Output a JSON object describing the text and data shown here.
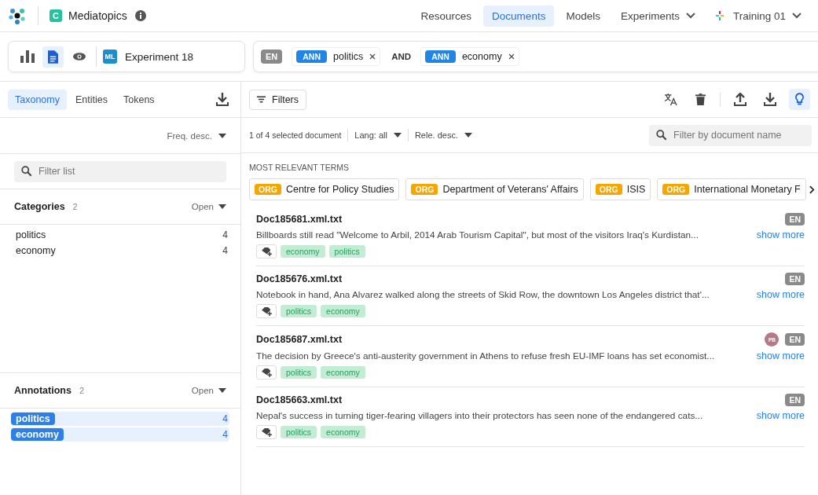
{
  "app": {
    "badge": "C",
    "title": "Mediatopics"
  },
  "nav": [
    {
      "label": "Resources",
      "selected": false,
      "dropdown": false
    },
    {
      "label": "Documents",
      "selected": true,
      "dropdown": false
    },
    {
      "label": "Models",
      "selected": false,
      "dropdown": false
    },
    {
      "label": "Experiments",
      "selected": false,
      "dropdown": true
    }
  ],
  "training": {
    "label": "Training 01"
  },
  "views": [
    {
      "kind": "chart",
      "selected": false
    },
    {
      "kind": "document",
      "selected": true
    },
    {
      "kind": "eye",
      "selected": false
    }
  ],
  "experiment": {
    "badge": "ML",
    "label": "Experiment 18"
  },
  "query": {
    "language": "EN",
    "terms": [
      {
        "tag": "ANN",
        "label": "politics"
      },
      {
        "tag": "ANN",
        "label": "economy"
      }
    ],
    "operator": "AND"
  },
  "left_tabs": [
    {
      "label": "Taxonomy",
      "selected": true
    },
    {
      "label": "Entities",
      "selected": false
    },
    {
      "label": "Tokens",
      "selected": false
    }
  ],
  "sort": "Freq. desc.",
  "filter_list": {
    "placeholder": "Filter list"
  },
  "sections": [
    {
      "title": "Categories",
      "count": "2",
      "toggle": "Open",
      "items": [
        {
          "label": "politics",
          "count": "4",
          "selected": false
        },
        {
          "label": "economy",
          "count": "4",
          "selected": false
        }
      ]
    },
    {
      "title": "Annotations",
      "count": "2",
      "toggle": "Open",
      "items": [
        {
          "label": "politics",
          "count": "4",
          "selected": true
        },
        {
          "label": "economy",
          "count": "4",
          "selected": true
        }
      ]
    }
  ],
  "filters_button": "Filters",
  "toolbar": [
    {
      "kind": "translate",
      "selected": false
    },
    {
      "kind": "trash",
      "selected": false
    },
    {
      "kind": "upload",
      "selected": false
    },
    {
      "kind": "download",
      "selected": false
    },
    {
      "kind": "bulb",
      "selected": true
    }
  ],
  "status": {
    "selection": "1 of 4 selected document",
    "lang": "Lang: all",
    "sort": "Rele. desc."
  },
  "doc_search": {
    "placeholder": "Filter by document name"
  },
  "terms_heading": "MOST RELEVANT TERMS",
  "terms": [
    {
      "tag": "ORG",
      "label": "Centre for Policy Studies"
    },
    {
      "tag": "ORG",
      "label": "Department of Veterans' Affairs"
    },
    {
      "tag": "ORG",
      "label": "ISIS"
    },
    {
      "tag": "ORG",
      "label": "International Monetary F"
    }
  ],
  "documents": [
    {
      "name": "Doc185681.xml.txt",
      "language": "EN",
      "text": "Billboards still read \"Welcome to Arbil, 2014 Arab Tourism Capital\", but most of the visitors Iraq's Kurdistan...",
      "more": "show more",
      "tags": [
        "economy",
        "politics"
      ]
    },
    {
      "name": "Doc185676.xml.txt",
      "language": "EN",
      "text": "Notebook in hand, Ana Alvarez walked along the streets of Skid Row, the downtown Los Angeles district that'...",
      "more": "show more",
      "tags": [
        "politics",
        "economy"
      ]
    },
    {
      "name": "Doc185687.xml.txt",
      "language": "EN",
      "annotator": "PB",
      "text": "The decision by Greece's anti-austerity government in Athens to refuse fresh EU-IMF loans has set economist...",
      "more": "show more",
      "tags": [
        "politics",
        "economy"
      ]
    },
    {
      "name": "Doc185663.xml.txt",
      "language": "EN",
      "text": "Nepal's success in turning tiger-fearing villagers into their protectors has seen none of the endangered cats...",
      "more": "show more",
      "tags": [
        "politics",
        "economy"
      ]
    }
  ]
}
